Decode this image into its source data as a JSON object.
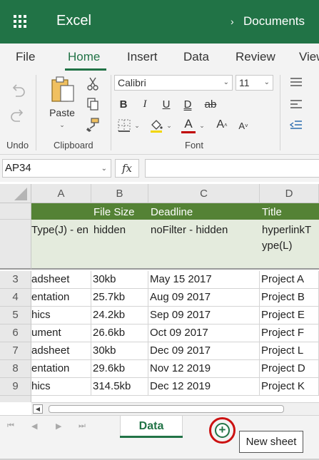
{
  "app": {
    "name": "Excel",
    "breadcrumb": "Documents"
  },
  "colors": {
    "brand": "#217346",
    "header_fill": "#548235",
    "tooltip_ring": "#cc1111"
  },
  "tabs": [
    "File",
    "Home",
    "Insert",
    "Data",
    "Review",
    "View"
  ],
  "active_tab": "Home",
  "ribbon": {
    "undo_label": "Undo",
    "clipboard_label": "Clipboard",
    "paste_label": "Paste",
    "font_label": "Font",
    "font_name": "Calibri",
    "font_size": "11",
    "bold": "B",
    "italic": "I",
    "underline": "U",
    "double_underline": "D",
    "strikethrough": "ab",
    "font_color_glyph": "A",
    "grow_font": "A",
    "shrink_font": "A"
  },
  "formula_bar": {
    "name_box": "AP34",
    "fx": "fx",
    "value": ""
  },
  "grid": {
    "columns": [
      "A",
      "B",
      "C",
      "D"
    ],
    "header_row": [
      "",
      "File Size",
      "Deadline",
      "Title"
    ],
    "subheader_row": {
      "a": "Type(J) - en",
      "b": "hidden",
      "c": "noFilter - hidden",
      "d": "hyperlinkT ype(L)"
    },
    "rows": [
      {
        "num": "3",
        "a": "adsheet",
        "b": "30kb",
        "c": "May 15 2017",
        "d": "Project A"
      },
      {
        "num": "4",
        "a": "entation",
        "b": "25.7kb",
        "c": "Aug 09 2017",
        "d": "Project B"
      },
      {
        "num": "5",
        "a": "hics",
        "b": "24.2kb",
        "c": "Sep 09 2017",
        "d": "Project E"
      },
      {
        "num": "6",
        "a": "ument",
        "b": "26.6kb",
        "c": "Oct 09 2017",
        "d": "Project F"
      },
      {
        "num": "7",
        "a": "adsheet",
        "b": "30kb",
        "c": "Dec 09 2017",
        "d": "Project L"
      },
      {
        "num": "8",
        "a": "entation",
        "b": "29.6kb",
        "c": "Nov 12 2019",
        "d": "Project D"
      },
      {
        "num": "9",
        "a": "hics",
        "b": "314.5kb",
        "c": "Dec 12 2019",
        "d": "Project K"
      }
    ]
  },
  "sheets": {
    "active": "Data",
    "add_tooltip": "New sheet"
  },
  "icons": {
    "apps": "waffle-icon",
    "undo": "undo-icon",
    "redo": "redo-icon",
    "paste": "clipboard-icon",
    "cut": "scissors-icon",
    "copy": "copy-icon",
    "format_painter": "paintbrush-icon",
    "borders": "borders-icon",
    "fill": "fill-bucket-icon",
    "add_sheet": "plus-circle-icon"
  }
}
